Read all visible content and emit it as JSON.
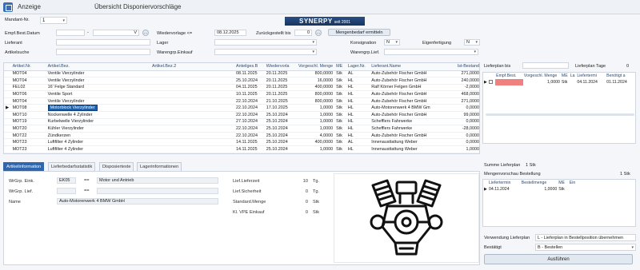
{
  "app": {
    "title": "Anzeige",
    "page_title": "Übersicht Disponiervorschläge"
  },
  "mandant": {
    "label": "Mandant-Nr.",
    "value": "1"
  },
  "logo": {
    "text": "SYNERPY",
    "sub": "seit 2001"
  },
  "filters": {
    "best_datum_label": "Empf.Best.Datum",
    "best_datum_sep": "-",
    "best_datum_dropdown_value": "V",
    "wiedervorlage_label": "Wiedervorlage <=",
    "wiedervorlage_value": "08.12.2025",
    "zurueck_label": "Zurückgestellt bis",
    "zurueck_value": "0",
    "mengenbedarf_button": "Mengenbedarf ermitteln",
    "lieferant_label": "Lieferant",
    "lager_label": "Lager",
    "konsignation_label": "Konsignation",
    "konsignation_value": "N",
    "eigenfertigung_label": "Eigenfertigung",
    "eigenfertigung_value": "N",
    "artikelsuche_label": "Artikelsuche",
    "wgr_einkauf_label": "Warengrp.Einkauf",
    "wgr_lief_label": "Warengrp.Lief."
  },
  "grid": {
    "columns": [
      "Artikel.Nr.",
      "Artikel.Bez.",
      "Artikel.Bez.2",
      "Anteilges.B",
      "Wiedervorla",
      "Vorgeschl. Menge",
      "ME",
      "Lager.Nr.",
      "Lieferant.Name",
      "Ist-Bestand"
    ],
    "rows": [
      [
        "MOT04",
        "Ventile Vierzylinder",
        "",
        "08.11.2025",
        "20.11.2025",
        "800,0000",
        "Stk",
        "AL",
        "Auto-Zubehör Fischer GmbH",
        "271,0000"
      ],
      [
        "MOT04",
        "Ventile Vierzylinder",
        "",
        "25.10.2024",
        "20.11.2025",
        "16,0000",
        "Stk",
        "HL",
        "Auto-Zubehör Fischer GmbH",
        "240,0000"
      ],
      [
        "FEL02",
        "16' Felge Standard",
        "",
        "04.11.2025",
        "20.11.2025",
        "400,0000",
        "Stk",
        "HL",
        "Ralf Körner Felgen GmbH",
        "-2,0000"
      ],
      [
        "MOT06",
        "Ventile Sport",
        "",
        "10.11.2025",
        "20.11.2025",
        "800,0000",
        "Stk",
        "HL",
        "Auto-Zubehör Fischer GmbH",
        "468,0000"
      ],
      [
        "MOT04",
        "Ventile Vierzylinder",
        "",
        "22.10.2024",
        "21.10.2025",
        "800,0000",
        "Stk",
        "HL",
        "Auto-Zubehör Fischer GmbH",
        "271,0000"
      ],
      [
        "MOT08",
        "Motorblock Vierzylinder",
        "",
        "22.10.2024",
        "17.10.2025",
        "1,0000",
        "Stk",
        "HL",
        "Auto-Motorenwerk 4 BMW Gm",
        "0,0000"
      ],
      [
        "MOT10",
        "Nockenwelle 4 Zylinder",
        "",
        "22.10.2024",
        "25.10.2024",
        "1,0000",
        "Stk",
        "HL",
        "Auto-Zubehör Fischer GmbH",
        "99,0000"
      ],
      [
        "MOT19",
        "Kurbelwelle Vierzylinder",
        "",
        "27.10.2024",
        "25.10.2024",
        "1,0000",
        "Stk",
        "HL",
        "Schefflers Fahrwerke",
        "0,0000"
      ],
      [
        "MOT20",
        "Kühler Vierzylinder",
        "",
        "22.10.2024",
        "25.10.2024",
        "1,0000",
        "Stk",
        "HL",
        "Schefflers Fahrwerke",
        "-28,0000"
      ],
      [
        "MOT22",
        "Zündkerzen",
        "",
        "22.10.2024",
        "25.10.2024",
        "4,0000",
        "Stk",
        "HL",
        "Auto-Zubehör Fischer GmbH",
        "0,0000"
      ],
      [
        "MOT23",
        "Luftfilter 4 Zylinder",
        "",
        "14.11.2025",
        "25.10.2024",
        "400,0000",
        "Stk",
        "AL",
        "Innenausttattung Weber",
        "0,0000"
      ],
      [
        "MOT23",
        "Luftfilter 4 Zylinder",
        "",
        "14.11.2025",
        "25.10.2024",
        "1,0000",
        "Stk",
        "HL",
        "Innenausttattung Weber",
        "1,0000"
      ]
    ],
    "selected_row": 5
  },
  "tabs": [
    "Artikelinformation",
    "Lieferbedarfsstatistik",
    "Disposiertexte",
    "Lagerinformationen"
  ],
  "detail": {
    "wgr_einkauf_label": "WrGrp. Eink.",
    "wgr_einkauf_code": "EK05",
    "wgr_einkauf_sep": "==",
    "wgr_einkauf_text": "Motor und Antrieb",
    "wgr_lief_label": "WrGrp. Lief.",
    "wgr_lief_sep": "==",
    "name_label": "Name",
    "name_value": "Auto-Motorenwerk 4 BMW GmbH",
    "lieferzeit_label": "Lief.Lieferzeit",
    "lieferzeit_value": "10",
    "lieferzeit_unit": "Tg.",
    "sicherheit_label": "Lief.Sicherheit",
    "sicherheit_value": "0",
    "sicherheit_unit": "Tg.",
    "standard_label": "Standard.Menge",
    "standard_value": "0",
    "standard_unit": "Stk",
    "vpe_label": "Kl. VPE Einkauf",
    "vpe_value": "0",
    "vpe_unit": "Stk"
  },
  "right": {
    "lieferplan_bis_label": "Lieferplan bis",
    "lieferplan_tage_label": "Lieferplan Tage",
    "lieferplan_tage_value": "0",
    "plan_columns": [
      "Empf.Best.",
      "Vorgeschl. Menge",
      "ME",
      "La",
      "Liefertermi",
      "Benötigt a"
    ],
    "plan_row": [
      "",
      "1,0000",
      "Stk",
      "",
      "04.11.2024",
      "01.11.2024"
    ],
    "summe_label": "Summe Lieferplan",
    "summe_value": "1 Stk",
    "mengenvorschau_label": "Mengenvorschau Bestellung",
    "mengenvorschau_value": "1 Stk",
    "vorschau_columns": [
      "Liefertermin",
      "Bestellmenge",
      "ME",
      "Ein"
    ],
    "vorschau_row": [
      "04.11.2024",
      "1,0000",
      "Stk",
      ""
    ],
    "verwendung_label": "Verwendung Lieferplan",
    "verwendung_value": "L - Lieferplan in Bestellposition übernehmen",
    "bestaetigt_label": "Bestätigt",
    "bestaetigt_value": "B - Bestellen",
    "ausfuehren": "Ausführen"
  }
}
